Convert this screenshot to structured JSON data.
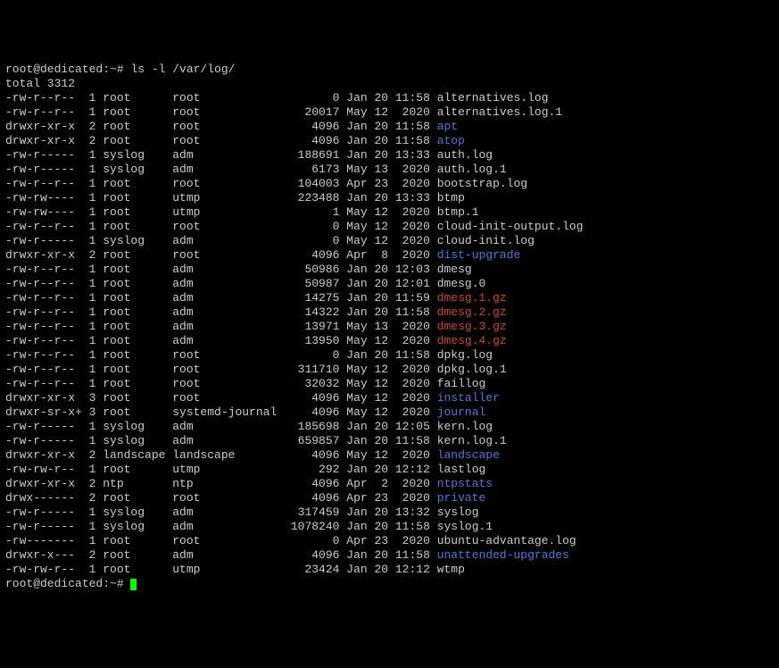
{
  "prompt": "root@dedicated:~#",
  "command": "ls -l /var/log/",
  "total_line": "total 3312",
  "rows": [
    {
      "perm": "-rw-r--r--",
      "links": "1",
      "owner": "root",
      "group": "root",
      "size": "0",
      "date": "Jan 20 11:58",
      "name": "alternatives.log",
      "type": "file"
    },
    {
      "perm": "-rw-r--r--",
      "links": "1",
      "owner": "root",
      "group": "root",
      "size": "20017",
      "date": "May 12  2020",
      "name": "alternatives.log.1",
      "type": "file"
    },
    {
      "perm": "drwxr-xr-x",
      "links": "2",
      "owner": "root",
      "group": "root",
      "size": "4096",
      "date": "Jan 20 11:58",
      "name": "apt",
      "type": "dir"
    },
    {
      "perm": "drwxr-xr-x",
      "links": "2",
      "owner": "root",
      "group": "root",
      "size": "4096",
      "date": "Jan 20 11:58",
      "name": "atop",
      "type": "dir"
    },
    {
      "perm": "-rw-r-----",
      "links": "1",
      "owner": "syslog",
      "group": "adm",
      "size": "188691",
      "date": "Jan 20 13:33",
      "name": "auth.log",
      "type": "file"
    },
    {
      "perm": "-rw-r-----",
      "links": "1",
      "owner": "syslog",
      "group": "adm",
      "size": "6173",
      "date": "May 13  2020",
      "name": "auth.log.1",
      "type": "file"
    },
    {
      "perm": "-rw-r--r--",
      "links": "1",
      "owner": "root",
      "group": "root",
      "size": "104003",
      "date": "Apr 23  2020",
      "name": "bootstrap.log",
      "type": "file"
    },
    {
      "perm": "-rw-rw----",
      "links": "1",
      "owner": "root",
      "group": "utmp",
      "size": "223488",
      "date": "Jan 20 13:33",
      "name": "btmp",
      "type": "file"
    },
    {
      "perm": "-rw-rw----",
      "links": "1",
      "owner": "root",
      "group": "utmp",
      "size": "1",
      "date": "May 12  2020",
      "name": "btmp.1",
      "type": "file"
    },
    {
      "perm": "-rw-r--r--",
      "links": "1",
      "owner": "root",
      "group": "root",
      "size": "0",
      "date": "May 12  2020",
      "name": "cloud-init-output.log",
      "type": "file"
    },
    {
      "perm": "-rw-r-----",
      "links": "1",
      "owner": "syslog",
      "group": "adm",
      "size": "0",
      "date": "May 12  2020",
      "name": "cloud-init.log",
      "type": "file"
    },
    {
      "perm": "drwxr-xr-x",
      "links": "2",
      "owner": "root",
      "group": "root",
      "size": "4096",
      "date": "Apr  8  2020",
      "name": "dist-upgrade",
      "type": "dir"
    },
    {
      "perm": "-rw-r--r--",
      "links": "1",
      "owner": "root",
      "group": "adm",
      "size": "50986",
      "date": "Jan 20 12:03",
      "name": "dmesg",
      "type": "file"
    },
    {
      "perm": "-rw-r--r--",
      "links": "1",
      "owner": "root",
      "group": "adm",
      "size": "50987",
      "date": "Jan 20 12:01",
      "name": "dmesg.0",
      "type": "file"
    },
    {
      "perm": "-rw-r--r--",
      "links": "1",
      "owner": "root",
      "group": "adm",
      "size": "14275",
      "date": "Jan 20 11:59",
      "name": "dmesg.1.gz",
      "type": "gz"
    },
    {
      "perm": "-rw-r--r--",
      "links": "1",
      "owner": "root",
      "group": "adm",
      "size": "14322",
      "date": "Jan 20 11:58",
      "name": "dmesg.2.gz",
      "type": "gz"
    },
    {
      "perm": "-rw-r--r--",
      "links": "1",
      "owner": "root",
      "group": "adm",
      "size": "13971",
      "date": "May 13  2020",
      "name": "dmesg.3.gz",
      "type": "gz"
    },
    {
      "perm": "-rw-r--r--",
      "links": "1",
      "owner": "root",
      "group": "adm",
      "size": "13950",
      "date": "May 12  2020",
      "name": "dmesg.4.gz",
      "type": "gz"
    },
    {
      "perm": "-rw-r--r--",
      "links": "1",
      "owner": "root",
      "group": "root",
      "size": "0",
      "date": "Jan 20 11:58",
      "name": "dpkg.log",
      "type": "file"
    },
    {
      "perm": "-rw-r--r--",
      "links": "1",
      "owner": "root",
      "group": "root",
      "size": "311710",
      "date": "May 12  2020",
      "name": "dpkg.log.1",
      "type": "file"
    },
    {
      "perm": "-rw-r--r--",
      "links": "1",
      "owner": "root",
      "group": "root",
      "size": "32032",
      "date": "May 12  2020",
      "name": "faillog",
      "type": "file"
    },
    {
      "perm": "drwxr-xr-x",
      "links": "3",
      "owner": "root",
      "group": "root",
      "size": "4096",
      "date": "May 12  2020",
      "name": "installer",
      "type": "dir"
    },
    {
      "perm": "drwxr-sr-x+",
      "links": "3",
      "owner": "root",
      "group": "systemd-journal",
      "size": "4096",
      "date": "May 12  2020",
      "name": "journal",
      "type": "dir"
    },
    {
      "perm": "-rw-r-----",
      "links": "1",
      "owner": "syslog",
      "group": "adm",
      "size": "185698",
      "date": "Jan 20 12:05",
      "name": "kern.log",
      "type": "file"
    },
    {
      "perm": "-rw-r-----",
      "links": "1",
      "owner": "syslog",
      "group": "adm",
      "size": "659857",
      "date": "Jan 20 11:58",
      "name": "kern.log.1",
      "type": "file"
    },
    {
      "perm": "drwxr-xr-x",
      "links": "2",
      "owner": "landscape",
      "group": "landscape",
      "size": "4096",
      "date": "May 12  2020",
      "name": "landscape",
      "type": "dir"
    },
    {
      "perm": "-rw-rw-r--",
      "links": "1",
      "owner": "root",
      "group": "utmp",
      "size": "292",
      "date": "Jan 20 12:12",
      "name": "lastlog",
      "type": "file"
    },
    {
      "perm": "drwxr-xr-x",
      "links": "2",
      "owner": "ntp",
      "group": "ntp",
      "size": "4096",
      "date": "Apr  2  2020",
      "name": "ntpstats",
      "type": "dir"
    },
    {
      "perm": "drwx------",
      "links": "2",
      "owner": "root",
      "group": "root",
      "size": "4096",
      "date": "Apr 23  2020",
      "name": "private",
      "type": "dir"
    },
    {
      "perm": "-rw-r-----",
      "links": "1",
      "owner": "syslog",
      "group": "adm",
      "size": "317459",
      "date": "Jan 20 13:32",
      "name": "syslog",
      "type": "file"
    },
    {
      "perm": "-rw-r-----",
      "links": "1",
      "owner": "syslog",
      "group": "adm",
      "size": "1078240",
      "date": "Jan 20 11:58",
      "name": "syslog.1",
      "type": "file"
    },
    {
      "perm": "-rw-------",
      "links": "1",
      "owner": "root",
      "group": "root",
      "size": "0",
      "date": "Apr 23  2020",
      "name": "ubuntu-advantage.log",
      "type": "file"
    },
    {
      "perm": "drwxr-x---",
      "links": "2",
      "owner": "root",
      "group": "adm",
      "size": "4096",
      "date": "Jan 20 11:58",
      "name": "unattended-upgrades",
      "type": "dir"
    },
    {
      "perm": "-rw-rw-r--",
      "links": "1",
      "owner": "root",
      "group": "utmp",
      "size": "23424",
      "date": "Jan 20 12:12",
      "name": "wtmp",
      "type": "file"
    }
  ],
  "final_prompt": "root@dedicated:~#"
}
